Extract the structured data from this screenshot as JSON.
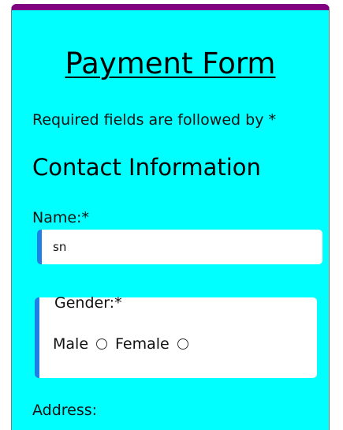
{
  "form": {
    "title": "Payment Form",
    "required_note": "Required fields are followed by *"
  },
  "contact": {
    "section_title": "Contact Information",
    "name_label": "Name:*",
    "name_value": "sn",
    "gender_label": "Gender:*",
    "gender_options": [
      "Male",
      "Female"
    ],
    "address_label": "Address:"
  },
  "colors": {
    "card_background": "#00ffff",
    "top_border": "#800080",
    "input_accent": "#1e7fe6"
  }
}
